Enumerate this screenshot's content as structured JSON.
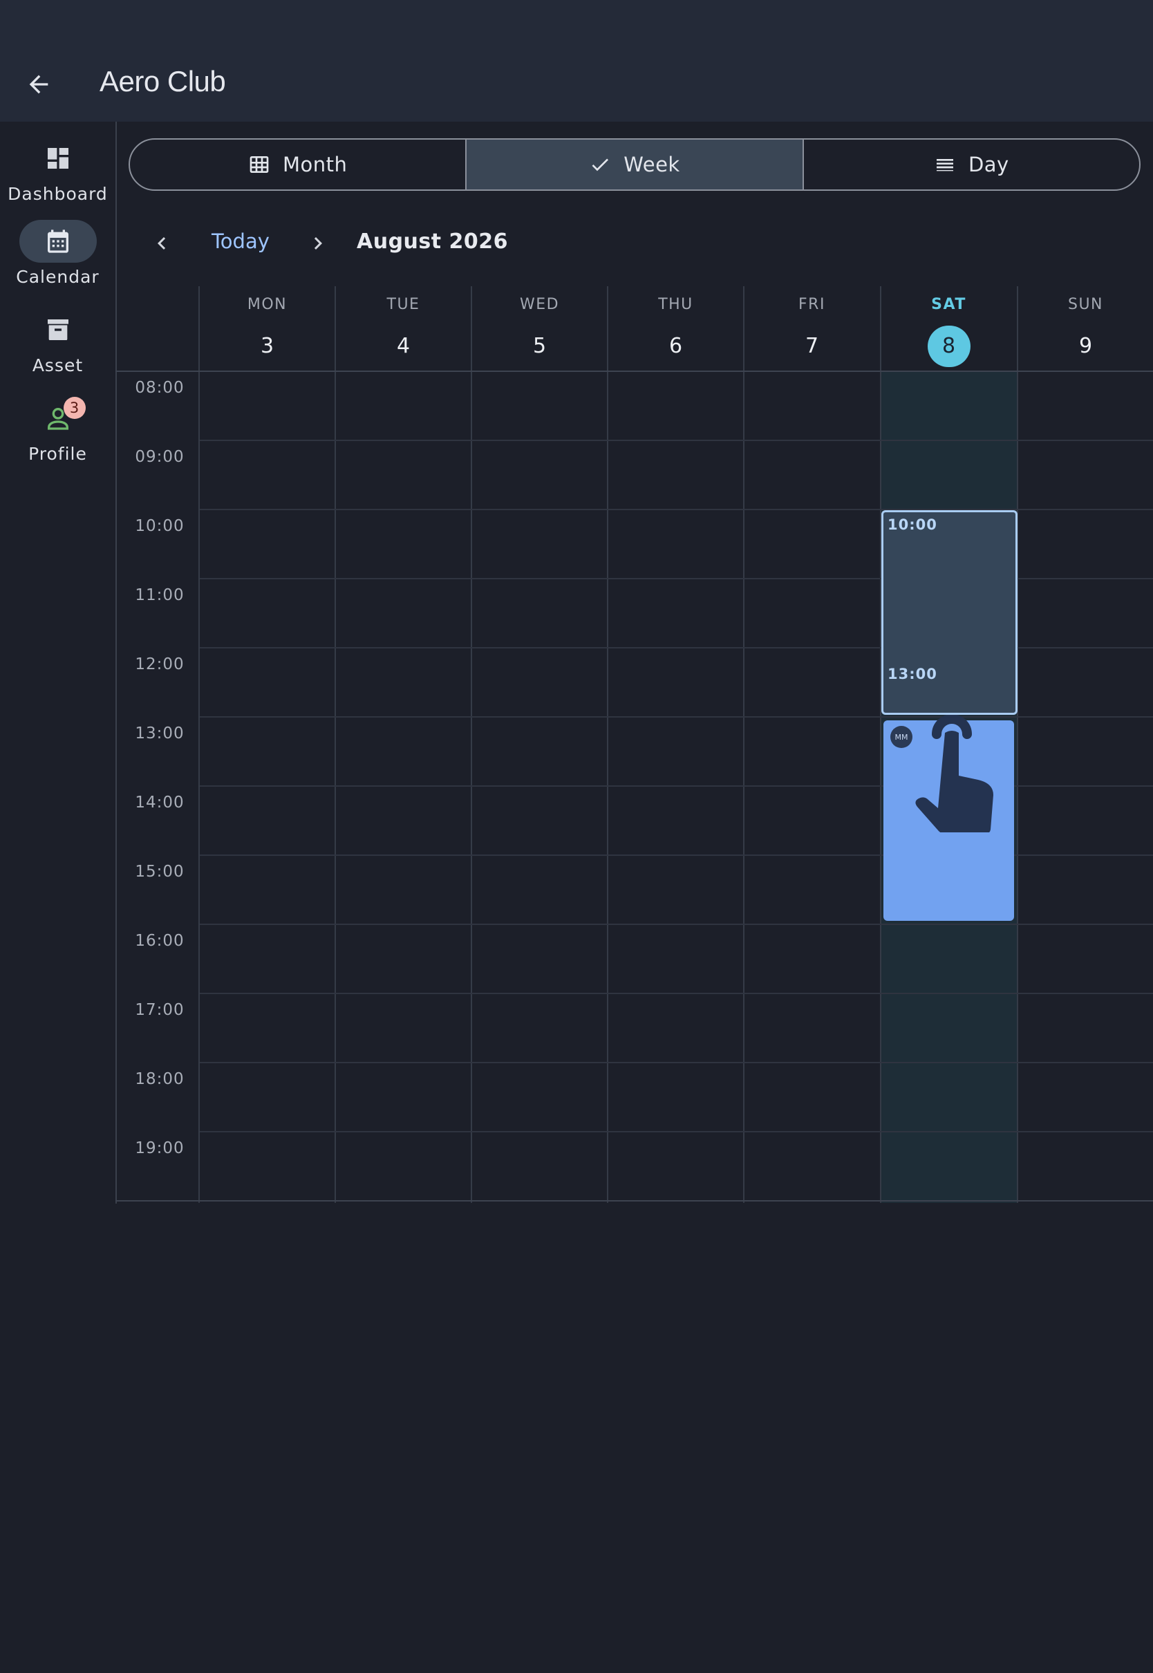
{
  "header": {
    "title": "Aero Club"
  },
  "rail": {
    "items": [
      {
        "label": "Dashboard",
        "icon": "dashboard-icon"
      },
      {
        "label": "Calendar",
        "icon": "calendar-icon",
        "active": true
      },
      {
        "label": "Asset",
        "icon": "archive-icon"
      },
      {
        "label": "Profile",
        "icon": "person-icon",
        "badge": "3"
      }
    ]
  },
  "view_switch": {
    "options": [
      {
        "label": "Month",
        "icon": "grid-icon"
      },
      {
        "label": "Week",
        "icon": "check-icon",
        "selected": true
      },
      {
        "label": "Day",
        "icon": "list-icon"
      }
    ]
  },
  "nav": {
    "today": "Today",
    "month": "August 2026"
  },
  "week": {
    "days": [
      {
        "dow": "MON",
        "num": "3"
      },
      {
        "dow": "TUE",
        "num": "4"
      },
      {
        "dow": "WED",
        "num": "5"
      },
      {
        "dow": "THU",
        "num": "6"
      },
      {
        "dow": "FRI",
        "num": "7"
      },
      {
        "dow": "SAT",
        "num": "8",
        "today": true
      },
      {
        "dow": "SUN",
        "num": "9"
      }
    ],
    "hours": [
      "08:00",
      "09:00",
      "10:00",
      "11:00",
      "12:00",
      "13:00",
      "14:00",
      "15:00",
      "16:00",
      "17:00",
      "18:00",
      "19:00"
    ]
  },
  "selection": {
    "start": "10:00",
    "end": "13:00"
  },
  "event": {
    "avatar": "MM"
  },
  "colors": {
    "today_accent": "#5ec8e2",
    "event": "#72a2f0",
    "link": "#9ec5ff"
  }
}
